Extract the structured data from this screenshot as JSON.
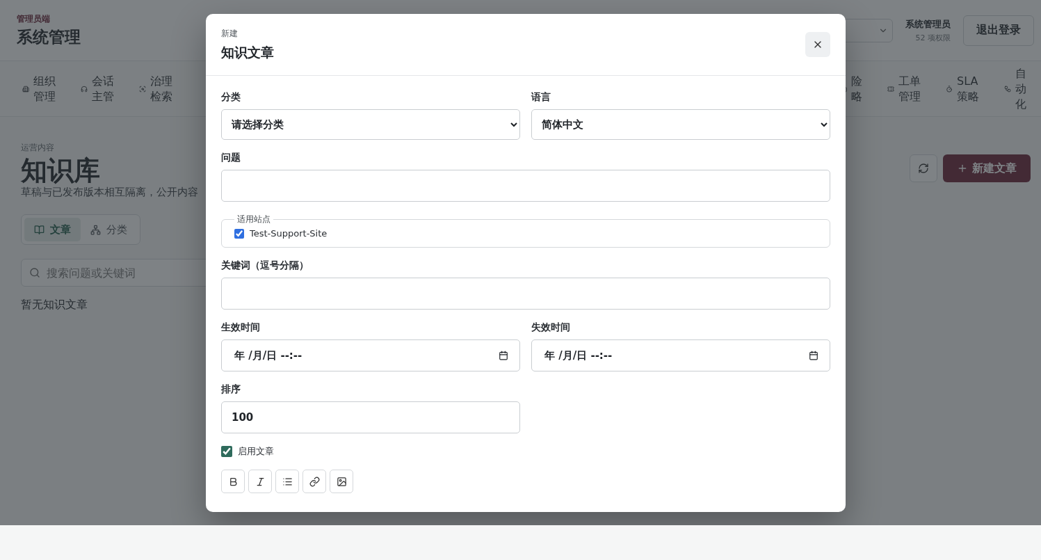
{
  "header": {
    "brand": "管理员端",
    "title": "系统管理",
    "user": {
      "name": "系统管理员",
      "permissions": "52 项权限"
    },
    "logout": "退出登录"
  },
  "nav_left": [
    {
      "lines": [
        "组织",
        "管理"
      ]
    },
    {
      "lines": [
        "会话",
        "主管"
      ]
    },
    {
      "lines": [
        "治理",
        "检索"
      ]
    }
  ],
  "nav_right": [
    {
      "lines": [
        "险",
        "略"
      ]
    },
    {
      "lines": [
        "工单",
        "管理"
      ]
    },
    {
      "lines": [
        "SLA",
        "策略"
      ]
    },
    {
      "lines": [
        "自",
        "动",
        "化"
      ]
    }
  ],
  "content": {
    "eyebrow": "运营内容",
    "title": "知识库",
    "description": "草稿与已发布版本相互隔离，公开内容",
    "tabs": [
      {
        "label": "文章",
        "selected": true
      },
      {
        "label": "分类",
        "selected": false
      }
    ],
    "search": {
      "placeholder": "搜索问题或关键词"
    },
    "empty": "暂无知识文章",
    "new_button": "新建文章"
  },
  "modal": {
    "eyebrow": "新建",
    "title": "知识文章",
    "category": {
      "label": "分类",
      "value": "请选择分类"
    },
    "language": {
      "label": "语言",
      "value": "简体中文"
    },
    "question": {
      "label": "问题"
    },
    "sites": {
      "legend": "适用站点",
      "items": [
        {
          "label": "Test-Support-Site",
          "checked": true
        }
      ]
    },
    "keywords": {
      "label": "关键词（逗号分隔）"
    },
    "effective": {
      "label": "生效时间",
      "value": "年 /月/日 --:--"
    },
    "expires": {
      "label": "失效时间",
      "value": "年 /月/日 --:--"
    },
    "sort": {
      "label": "排序",
      "value": "100"
    },
    "enabled": {
      "label": "启用文章",
      "checked": true
    },
    "toolbar": [
      {
        "kind": "bold"
      },
      {
        "kind": "italic"
      },
      {
        "kind": "list"
      },
      {
        "kind": "link"
      },
      {
        "kind": "image"
      }
    ]
  }
}
